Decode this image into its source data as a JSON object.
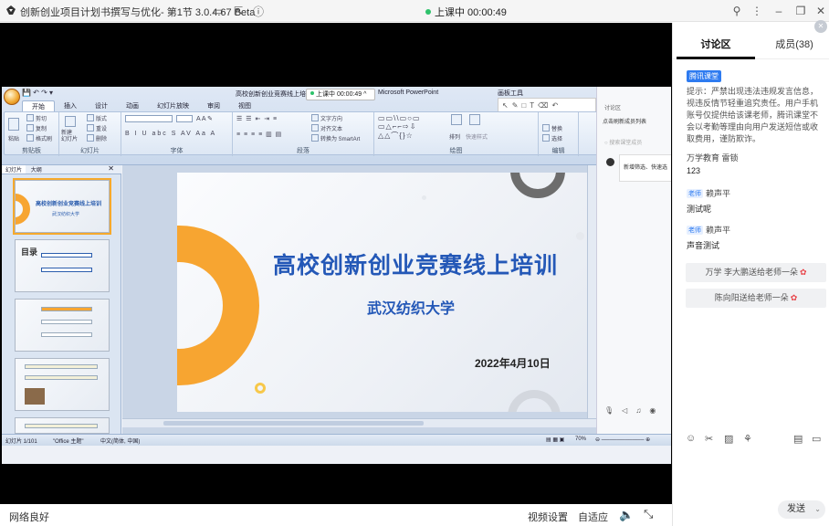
{
  "window": {
    "title": "创新创业项目计划书撰写与优化- 第1节 3.0.4.67 Beta",
    "live_status": "上课中 00:00:49"
  },
  "ppt": {
    "doc_title": "高校创新创业竞赛线上培",
    "app_name": "Microsoft PowerPoint",
    "tool_title": "画板工具",
    "live_pill": "上课中 00:00:49",
    "tabs": [
      "开始",
      "插入",
      "设计",
      "动画",
      "幻灯片放映",
      "审阅",
      "视图"
    ],
    "ribbon_groups": [
      "剪贴板",
      "幻灯片",
      "字体",
      "段落",
      "绘图",
      "编辑"
    ],
    "clipboard": {
      "paste": "粘贴",
      "cut": "剪切",
      "copy": "复制",
      "format": "格式刷"
    },
    "slides_grp": {
      "new": "新建\n幻灯片",
      "layout": "版式",
      "reset": "重设",
      "delete": "删除"
    },
    "paragraph": {
      "dir": "文字方向",
      "align": "对齐文本",
      "smartart": "转换为 SmartArt"
    },
    "drawing": {
      "arrange": "排列",
      "quick": "快速样式"
    },
    "editing": {
      "replace": "替换",
      "select": "选择"
    },
    "thumb_tabs": [
      "幻灯片",
      "大纲"
    ],
    "thumbnails": [
      {
        "n": "1",
        "title": "高校创新创业竞赛线上培训",
        "sub": "武汉纺织大学"
      },
      {
        "n": "2",
        "title": "目录",
        "sub": ""
      },
      {
        "n": "3",
        "title": "",
        "sub": ""
      },
      {
        "n": "4",
        "title": "",
        "sub": ""
      },
      {
        "n": "5",
        "title": "",
        "sub": ""
      }
    ],
    "slide": {
      "title": "高校创新创业竞赛线上培训",
      "subtitle": "武汉纺织大学",
      "date": "2022年4月10日"
    },
    "statusbar": {
      "slide": "幻灯片 1/101",
      "theme": "\"Office 主题\"",
      "lang": "中文(简体, 中国)",
      "zoom": "70%"
    },
    "side_popup": {
      "title": "讨论区",
      "link": "点击刷新成员列表",
      "search": "搜索课堂成员",
      "card": "新增筛选、快速选"
    }
  },
  "bottombar": {
    "network": "网络良好",
    "video_settings": "视频设置",
    "adaptive": "自适应"
  },
  "panel": {
    "tabs": [
      "讨论区",
      "成员(38)"
    ],
    "badge": "腾讯课堂",
    "notice": "提示：严禁出现违法违规发言信息，视违反情节轻重追究责任。用户手机账号仅提供给该课老师，腾讯课堂不会以考勤等理由向用户发送短信或收取费用，谨防欺诈。",
    "messages": [
      {
        "name": "万学教育 雷锁",
        "teacher": false,
        "text": "123"
      },
      {
        "name": "赖声平",
        "teacher": true,
        "text": "测试呢"
      },
      {
        "name": "赖声平",
        "teacher": true,
        "text": "声音测试"
      }
    ],
    "teacher_badge": "老师",
    "flowers": [
      "万学 李大鹏送给老师一朵",
      "陈向阳送给老师一朵"
    ],
    "send": "发送"
  }
}
